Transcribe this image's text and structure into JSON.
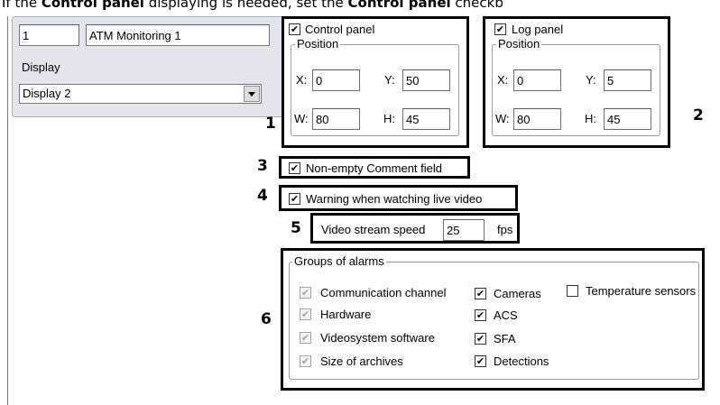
{
  "caption": {
    "pre": "If the ",
    "bold1": "Control panel",
    "mid": " displaying is needed, set the ",
    "bold2": "Control panel",
    "post": " checkb"
  },
  "monitor": {
    "id": "1",
    "name": "ATM Monitoring 1",
    "display_label": "Display",
    "display_value": "Display 2"
  },
  "control_panel": {
    "label": "Control panel",
    "checked": true,
    "position_label": "Position",
    "x_label": "X:",
    "x": "0",
    "y_label": "Y:",
    "y": "50",
    "w_label": "W:",
    "w": "80",
    "h_label": "H:",
    "h": "45"
  },
  "log_panel": {
    "label": "Log panel",
    "checked": true,
    "position_label": "Position",
    "x_label": "X:",
    "x": "0",
    "y_label": "Y:",
    "y": "5",
    "w_label": "W:",
    "w": "80",
    "h_label": "H:",
    "h": "45"
  },
  "comment": {
    "label": "Non-empty Comment field",
    "checked": true
  },
  "warning": {
    "label": "Warning when watching live video",
    "checked": true
  },
  "speed": {
    "label": "Video stream speed",
    "value": "25",
    "unit": "fps"
  },
  "alarms": {
    "title": "Groups of alarms",
    "col1": [
      {
        "label": "Communication channel",
        "checked": true,
        "disabled": true
      },
      {
        "label": "Hardware",
        "checked": true,
        "disabled": true
      },
      {
        "label": "Videosystem software",
        "checked": true,
        "disabled": true
      },
      {
        "label": "Size of archives",
        "checked": true,
        "disabled": true
      }
    ],
    "col2": [
      {
        "label": "Cameras",
        "checked": true
      },
      {
        "label": "ACS",
        "checked": true
      },
      {
        "label": "SFA",
        "checked": true
      },
      {
        "label": "Detections",
        "checked": true
      }
    ],
    "col3": [
      {
        "label": "Temperature sensors",
        "checked": false
      }
    ]
  },
  "callouts": [
    "1",
    "2",
    "3",
    "4",
    "5",
    "6"
  ],
  "check_glyph": "✔"
}
